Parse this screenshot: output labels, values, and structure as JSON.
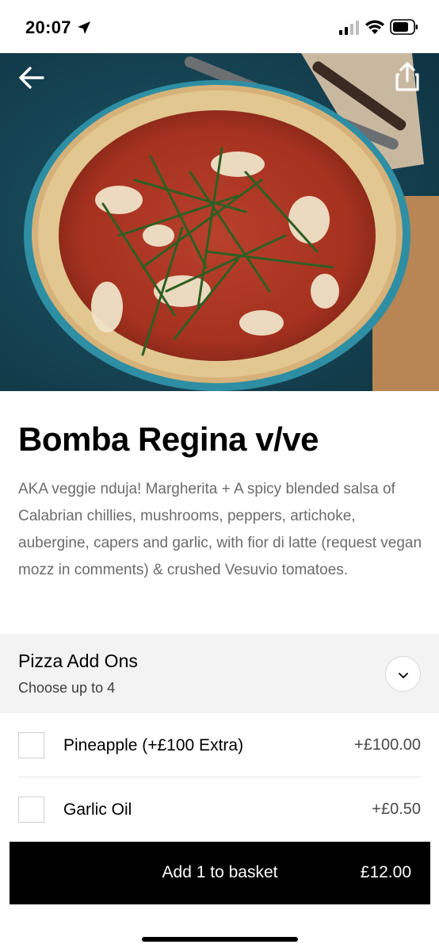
{
  "status_bar": {
    "time": "20:07",
    "icons": [
      "location-arrow-icon",
      "signal-icon",
      "wifi-icon",
      "battery-icon"
    ]
  },
  "hero": {
    "icons": [
      "back-arrow-icon",
      "share-icon"
    ]
  },
  "item": {
    "title": "Bomba Regina v/ve",
    "description": "AKA veggie nduja! Margherita + A spicy blended salsa of Calabrian chillies, mushrooms, peppers, artichoke, aubergine, capers and garlic, with fior di latte (request vegan mozz in comments) & crushed Vesuvio tomatoes."
  },
  "addons": {
    "title": "Pizza Add Ons",
    "subtitle": "Choose up to 4",
    "icon": "chevron-down-icon",
    "options": [
      {
        "label": "Pineapple (+£100 Extra)",
        "price": "+£100.00",
        "checked": false
      },
      {
        "label": "Garlic Oil",
        "price": "+£0.50",
        "checked": false
      }
    ]
  },
  "basket": {
    "label": "Add 1 to basket",
    "price": "£12.00"
  },
  "colors": {
    "accent": "#000000",
    "section_bg": "#f3f3f3",
    "description_text": "#6b6b6b"
  }
}
